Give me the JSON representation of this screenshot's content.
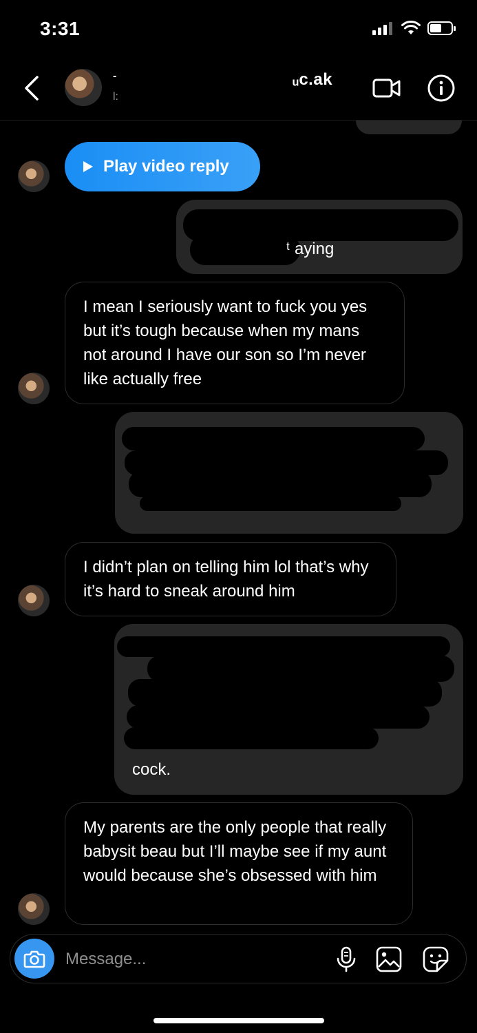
{
  "status_bar": {
    "time": "3:31"
  },
  "header": {
    "name_fragment": "-",
    "sub_fragment": "l:",
    "name_tail": "ᵤc.ak",
    "icons": {
      "back": "chevron-left-icon",
      "video": "video-camera-icon",
      "info": "info-circle-icon"
    }
  },
  "messages": {
    "video_reply_label": "Play video reply",
    "out_1_visible": "ᵗ aying",
    "in_1": "I mean I seriously want to fuck you yes but it’s tough because when my mans not around I have our son so I’m never like actually free",
    "in_2": "I didn’t plan on telling him lol that’s why it’s hard to sneak around him",
    "out_3_visible": "cock.",
    "in_3": "My parents are the only people that really babysit beau but I’ll maybe see if my aunt would because she’s obsessed with him"
  },
  "composer": {
    "placeholder": "Message...",
    "icons": [
      "camera-icon",
      "microphone-icon",
      "gallery-icon",
      "sticker-icon"
    ]
  },
  "colors": {
    "accent": "#3797f0",
    "outgoing_bubble": "#262626",
    "incoming_border": "#2c2c2c"
  }
}
